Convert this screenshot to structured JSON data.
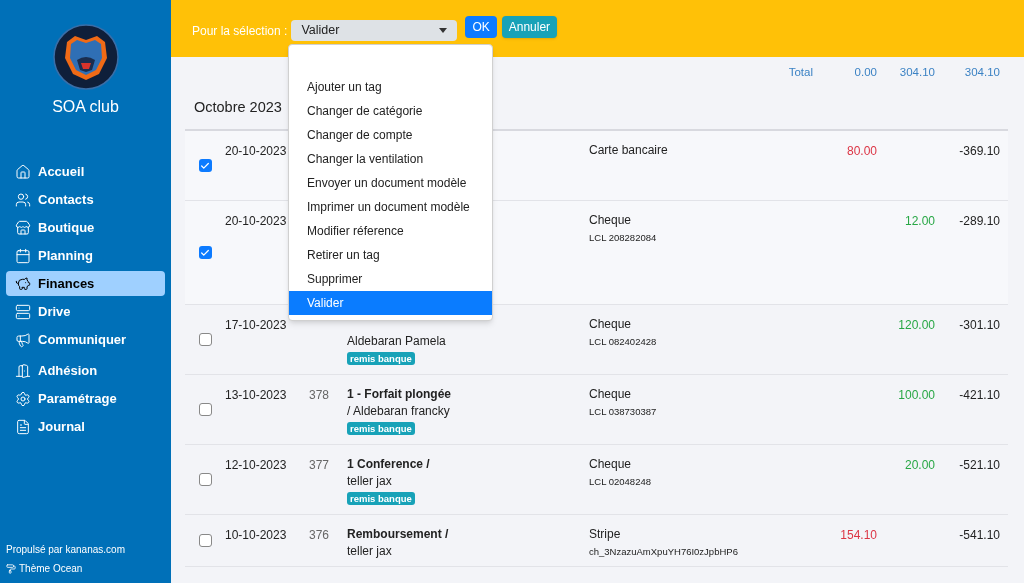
{
  "sidebar": {
    "club_name": "SOA club",
    "items": [
      {
        "label": "Accueil",
        "selected": false
      },
      {
        "label": "Contacts",
        "selected": false
      },
      {
        "label": "Boutique",
        "selected": false
      },
      {
        "label": "Planning",
        "selected": false
      },
      {
        "label": "Finances",
        "selected": true
      },
      {
        "label": "Drive",
        "selected": false
      },
      {
        "label": "Communiquer",
        "selected": false
      },
      {
        "label": "Adhésion",
        "selected": false
      },
      {
        "label": "Paramétrage",
        "selected": false
      },
      {
        "label": "Journal",
        "selected": false
      }
    ],
    "footer": {
      "powered_by": "Propulsé par kananas.com",
      "theme": "Thème Ocean"
    }
  },
  "toolbar": {
    "label": "Pour la sélection :",
    "select_value": "Valider",
    "ok": "OK",
    "cancel": "Annuler",
    "options": [
      {
        "label": "Ajouter un tag",
        "selected": false
      },
      {
        "label": "Changer de catégorie",
        "selected": false
      },
      {
        "label": "Changer de compte",
        "selected": false
      },
      {
        "label": "Changer la ventilation",
        "selected": false
      },
      {
        "label": "Envoyer un document modèle",
        "selected": false
      },
      {
        "label": "Imprimer un document modèle",
        "selected": false
      },
      {
        "label": "Modifier réference",
        "selected": false
      },
      {
        "label": "Retirer un tag",
        "selected": false
      },
      {
        "label": "Supprimer",
        "selected": false
      },
      {
        "label": "Valider",
        "selected": true
      }
    ]
  },
  "totals": {
    "label": "Total",
    "debit": "0.00",
    "credit": "304.10",
    "balance": "304.10"
  },
  "month": "Octobre 2023",
  "rows": [
    {
      "checked": true,
      "date": "20-10-2023",
      "payment": "Carte bancaire",
      "debit": "80.00",
      "balance": "-369.10"
    },
    {
      "checked": true,
      "date": "20-10-2023",
      "payment": "Cheque",
      "reference": "LCL 208282084",
      "credit": "12.00",
      "balance": "-289.10"
    },
    {
      "checked": false,
      "date": "17-10-2023",
      "subtitle": "Aldebaran Pamela",
      "tag": "remis banque",
      "payment": "Cheque",
      "reference": "LCL 082402428",
      "credit": "120.00",
      "balance": "-301.10"
    },
    {
      "checked": false,
      "date": "13-10-2023",
      "number": "378",
      "title": "1 - Forfait plongée",
      "subtitle": "/ Aldebaran francky",
      "tag": "remis banque",
      "payment": "Cheque",
      "reference": "LCL 038730387",
      "credit": "100.00",
      "balance": "-421.10"
    },
    {
      "checked": false,
      "date": "12-10-2023",
      "number": "377",
      "title": "1 Conference /",
      "subtitle": "teller jax",
      "tag": "remis banque",
      "payment": "Cheque",
      "reference": "LCL 02048248",
      "credit": "20.00",
      "balance": "-521.10"
    },
    {
      "checked": false,
      "date": "10-10-2023",
      "number": "376",
      "title": "Remboursement /",
      "subtitle": "teller jax",
      "payment": "Stripe",
      "reference": "ch_3NzazuAmXpuYH76I0zJpbHP6",
      "debit": "154.10",
      "balance": "-541.10"
    }
  ]
}
